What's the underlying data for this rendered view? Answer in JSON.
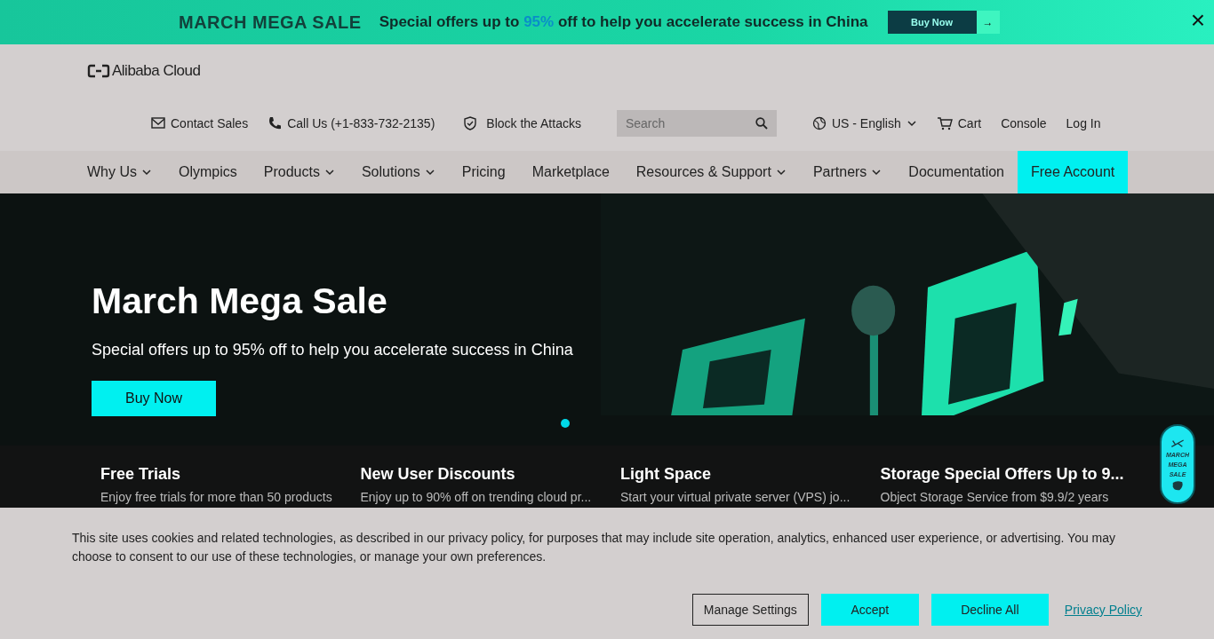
{
  "promo_banner": {
    "title": "MARCH MEGA SALE",
    "text_before": "Special offers up to",
    "highlight": "95%",
    "text_after": "off to help you accelerate success in China",
    "button": "Buy Now",
    "arrow": "→",
    "close": "×"
  },
  "header": {
    "logo": "Alibaba Cloud",
    "utility_links": [
      {
        "kind": "mail",
        "label": "Contact Sales"
      },
      {
        "kind": "phone",
        "label": "Call Us (+1-833-732-2135)"
      },
      {
        "kind": "shield",
        "label": "Block the Attacks"
      }
    ],
    "search": {
      "placeholder": "Search"
    },
    "language": "US - English",
    "cart": "Cart",
    "console": "Console",
    "login": "Log In"
  },
  "nav": [
    {
      "label": "Why Us",
      "dropdown": true,
      "selected": false
    },
    {
      "label": "Olympics",
      "dropdown": false,
      "selected": false
    },
    {
      "label": "Products",
      "dropdown": true,
      "selected": false
    },
    {
      "label": "Solutions",
      "dropdown": true,
      "selected": false
    },
    {
      "label": "Pricing",
      "dropdown": false,
      "selected": false
    },
    {
      "label": "Marketplace",
      "dropdown": false,
      "selected": false
    },
    {
      "label": "Resources & Support",
      "dropdown": true,
      "selected": false
    },
    {
      "label": "Partners",
      "dropdown": true,
      "selected": false
    },
    {
      "label": "Documentation",
      "dropdown": false,
      "selected": false
    },
    {
      "label": "Free Account",
      "dropdown": false,
      "selected": true
    }
  ],
  "hero": {
    "title": "March Mega Sale",
    "subtitle": "Special offers up to 95% off to help you accelerate success in China",
    "button": "Buy Now",
    "dots": [
      {
        "selected": true
      }
    ]
  },
  "features": [
    {
      "title": "Free Trials",
      "text": "Enjoy free trials for more than 50 products"
    },
    {
      "title": "New User Discounts",
      "text": "Enjoy up to 90% off on trending cloud pr..."
    },
    {
      "title": "Light Space",
      "text": "Start your virtual private server (VPS) jo..."
    },
    {
      "title": "Storage Special Offers Up to 9...",
      "text": "Object Storage Service from $9.9/2 years"
    }
  ],
  "floating_badge": "MARCH MEGA SALE",
  "cookie_banner": {
    "text": "This site uses cookies and related technologies, as described in our privacy policy, for purposes that may include site operation, analytics, enhanced user experience, or advertising. You may choose to consent to our use of these technologies, or manage your own preferences.",
    "buttons": [
      {
        "kind": "outline",
        "label": "Manage Settings"
      },
      {
        "kind": "filled",
        "label": "Accept"
      },
      {
        "kind": "filled",
        "label": "Decline All"
      },
      {
        "kind": "link",
        "label": "Privacy Policy"
      }
    ]
  }
}
